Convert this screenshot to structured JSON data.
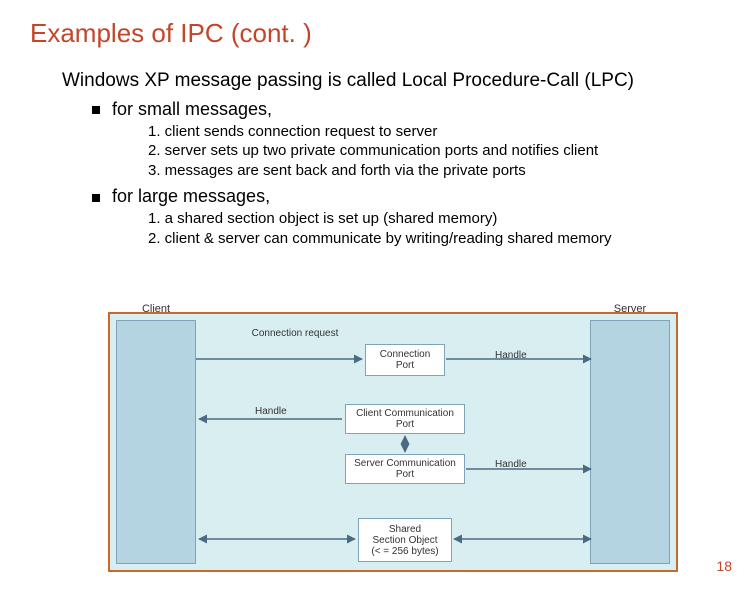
{
  "title": "Examples of IPC (cont. )",
  "intro": "Windows XP message passing is called Local Procedure-Call (LPC)",
  "bullets": {
    "b1": "for small messages,",
    "b2": "for large messages,"
  },
  "list1": {
    "i1": "1.  client sends connection request to server",
    "i2": "2.  server sets up two private communication ports and notifies client",
    "i3": "3.  messages are sent back and forth via the private ports"
  },
  "list2": {
    "i1": "1.  a shared section object is set up (shared memory)",
    "i2": "2.  client & server can communicate by writing/reading shared memory"
  },
  "diagram": {
    "client": "Client",
    "server": "Server",
    "conn_port": "Connection Port",
    "client_port": "Client Communication Port",
    "server_port": "Server Communication Port",
    "shared_obj_l1": "Shared",
    "shared_obj_l2": "Section Object",
    "shared_obj_l3": "(< = 256 bytes)",
    "conn_req": "Connection request",
    "handle1": "Handle",
    "handle2": "Handle",
    "handle3": "Handle"
  },
  "page_num": "18"
}
